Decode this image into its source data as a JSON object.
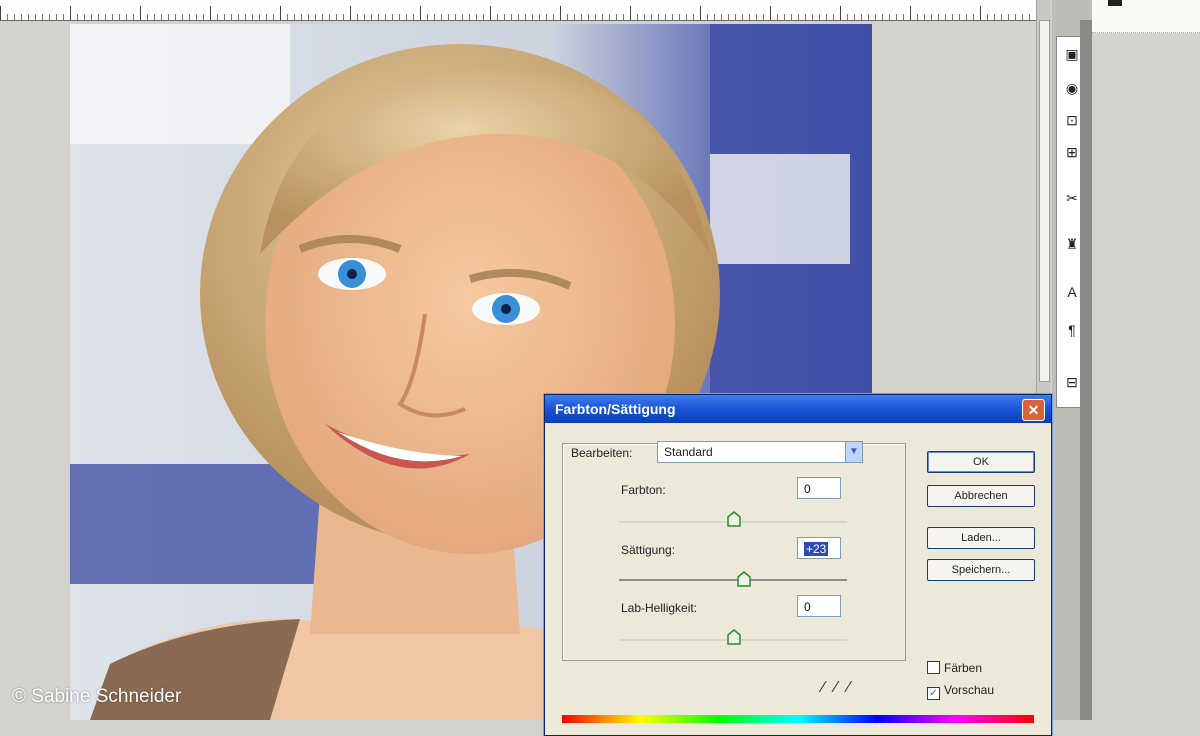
{
  "copyright": "© Sabine Schneider",
  "dialog": {
    "title": "Farbton/Sättigung",
    "close_glyph": "✕",
    "edit_label": "Bearbeiten:",
    "edit_value": "Standard",
    "sliders": [
      {
        "label": "Farbton:",
        "value": "0",
        "level": 0.5
      },
      {
        "label": "Sättigung:",
        "value": "+23",
        "level": 0.56
      },
      {
        "label": "Lab-Helligkeit:",
        "value": "0",
        "level": 0.5
      }
    ],
    "buttons": {
      "ok": "OK",
      "cancel": "Abbrechen",
      "load": "Laden...",
      "save": "Speichern..."
    },
    "checkboxes": {
      "colorize": {
        "label": "Färben",
        "checked": false
      },
      "preview": {
        "label": "Vorschau",
        "checked": true
      }
    },
    "eyedroppers": [
      "eyedropper-icon",
      "eyedropper-plus-icon",
      "eyedropper-minus-icon"
    ]
  },
  "toolbar": {
    "tools": [
      "layers-icon",
      "brush-icon",
      "crop-icon",
      "text-frame-icon",
      "scissors-icon",
      "stamp-icon",
      "type-icon",
      "paragraph-icon",
      "frame-icon"
    ]
  },
  "colors": {
    "titlebar": "#1c57d8",
    "dialog_bg": "#ece9d8",
    "canvas_bg": "#d3d2cc"
  }
}
